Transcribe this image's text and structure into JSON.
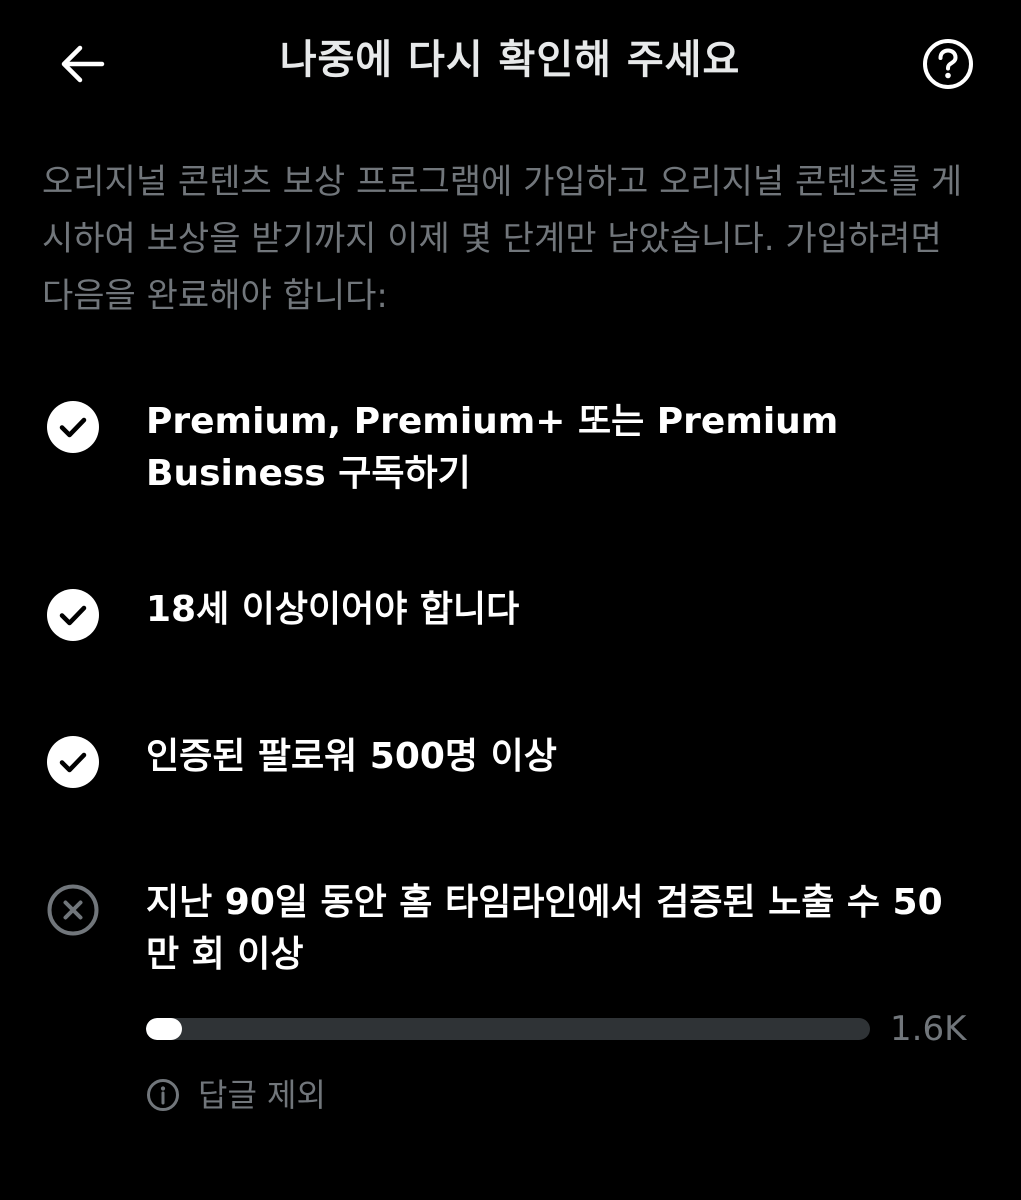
{
  "header": {
    "title": "나중에 다시 확인해 주세요",
    "back_icon": "arrow-left-icon",
    "help_icon": "question-circle-icon"
  },
  "intro": {
    "text": "오리지널 콘텐츠 보상 프로그램에 가입하고 오리지널 콘텐츠를 게시하여 보상을 받기까지 이제 몇 단계만 남았습니다. 가입하려면 다음을 완료해야 합니다:"
  },
  "requirements": [
    {
      "text": "Premium, Premium+ 또는 Premium Business 구독하기",
      "status": "complete",
      "icon": "check-circle-icon"
    },
    {
      "text": "18세 이상이어야 합니다",
      "status": "complete",
      "icon": "check-circle-icon"
    },
    {
      "text": "인증된 팔로워 500명 이상",
      "status": "complete",
      "icon": "check-circle-icon"
    },
    {
      "text": "지난 90일 동안 홈 타임라인에서 검증된 노출 수 50만 회 이상",
      "status": "incomplete",
      "icon": "x-circle-icon"
    }
  ],
  "progress": {
    "value_label": "1.6K",
    "fraction": 0.05
  },
  "note": {
    "text": "답글 제외",
    "icon": "info-circle-icon"
  },
  "colors": {
    "background": "#000000",
    "primary_text": "#ffffff",
    "secondary_text": "#71767b",
    "track": "#2f3336",
    "incomplete_icon": "#71767b"
  }
}
